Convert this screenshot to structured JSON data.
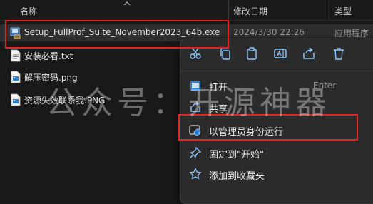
{
  "columns": {
    "name": "名称",
    "date": "修改日期",
    "type": "类型"
  },
  "files": [
    {
      "name": "Setup_FullProf_Suite_November2023_64b.exe",
      "date": "2024/3/30 22:26",
      "type": "应用程序",
      "icon": "installer-icon"
    },
    {
      "name": "安装必看.txt",
      "icon": "text-file-icon"
    },
    {
      "name": "解压密码.png",
      "icon": "image-file-icon"
    },
    {
      "name": "资源失效联系我.PNG",
      "icon": "image-file-icon"
    }
  ],
  "context_menu": {
    "quick_actions": [
      "cut-icon",
      "copy-icon",
      "paste-icon",
      "rename-icon",
      "share-icon",
      "delete-icon"
    ],
    "items": [
      {
        "label": "打开",
        "accelerator": "Enter",
        "icon": "open-icon"
      },
      {
        "label": "共享",
        "icon": "share-icon"
      },
      {
        "label": "以管理员身份运行",
        "icon": "admin-shield-icon"
      },
      {
        "label": "固定到\"开始\"",
        "icon": "pin-icon"
      },
      {
        "label": "添加到收藏夹",
        "icon": "star-icon"
      }
    ]
  },
  "watermark": "公众号：开源神器",
  "colors": {
    "highlight": "#e02525",
    "background": "#191919",
    "menu": "#2b2b2b"
  }
}
